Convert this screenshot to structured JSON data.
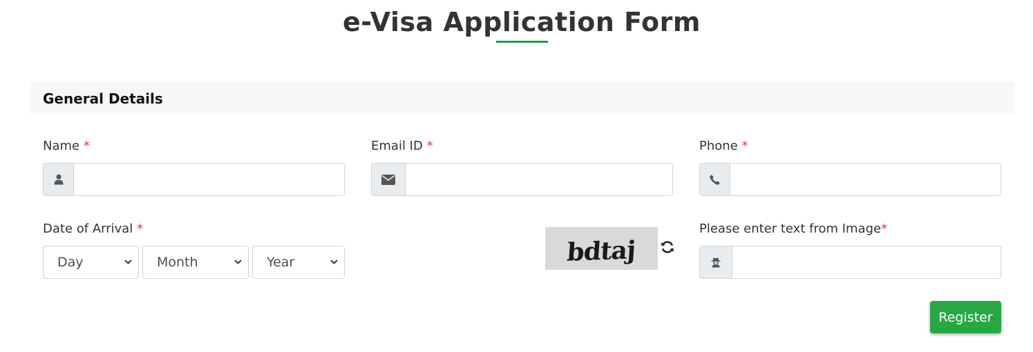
{
  "page": {
    "title": "e-Visa Application Form"
  },
  "section": {
    "title": "General Details"
  },
  "fields": {
    "name": {
      "label": "Name ",
      "required_mark": "*",
      "icon": "user-icon",
      "value": ""
    },
    "email": {
      "label": "Email ID ",
      "required_mark": "*",
      "icon": "envelope-icon",
      "value": ""
    },
    "phone": {
      "label": "Phone ",
      "required_mark": "*",
      "icon": "phone-icon",
      "value": ""
    },
    "arrival": {
      "label": "Date of Arrival ",
      "required_mark": "*",
      "day": "Day",
      "month": "Month",
      "year": "Year"
    },
    "captcha": {
      "image_text": "bdtaj",
      "label": "Please enter text from Image",
      "required_mark": "*",
      "icon": "spy-icon",
      "refresh_icon": "refresh-icon",
      "value": ""
    }
  },
  "actions": {
    "register_label": "Register"
  },
  "colors": {
    "accent": "#28a745",
    "underline": "#1a9a4a",
    "required": "#dc3545",
    "section_bg": "#f7f7f7"
  }
}
